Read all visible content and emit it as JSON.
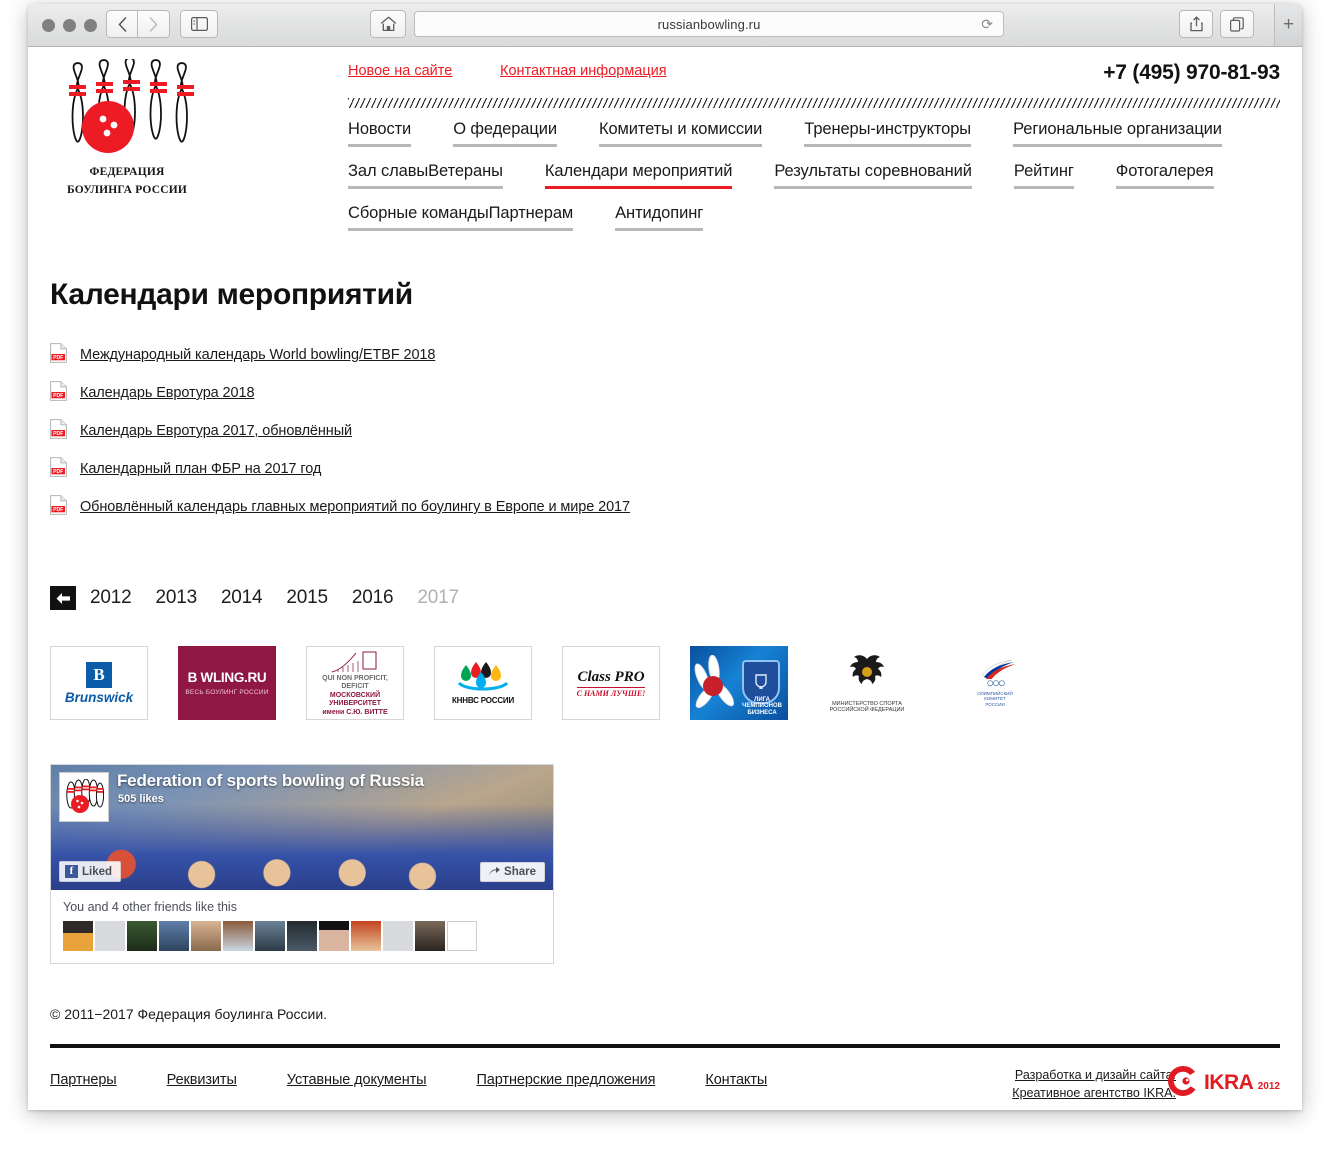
{
  "browser": {
    "url": "russianbowling.ru",
    "back_icon": "chevron-left-icon",
    "forward_icon": "chevron-right-icon",
    "sidebar_icon": "sidebar-icon",
    "home_icon": "home-icon",
    "reload_icon": "reload-icon",
    "share_icon": "share-icon",
    "tabs_icon": "tabs-icon",
    "newtab_label": "+"
  },
  "site": {
    "logo_text": "ФЕДЕРАЦИЯ\nБОУЛИНГА РОССИИ",
    "logo_line1": "ФЕДЕРАЦИЯ",
    "logo_line2": "БОУЛИНГА РОССИИ",
    "phone": "+7 (495) 970-81-93",
    "accent_red": "#ed1c24",
    "top_links": [
      {
        "label": "Новое на сайте"
      },
      {
        "label": "Контактная информация"
      }
    ],
    "menu": [
      {
        "label": "Новости",
        "active": false
      },
      {
        "label": "О федерации",
        "active": false
      },
      {
        "label": "Комитеты и комиссии",
        "active": false
      },
      {
        "label": "Тренеры-инструкторы",
        "active": false
      },
      {
        "label": "Региональные организации",
        "active": false
      },
      {
        "label": "Зал славы",
        "active": false
      },
      {
        "label": "Ветераны",
        "active": false
      },
      {
        "label": "Календари мероприятий",
        "active": true
      },
      {
        "label": "Результаты соревнований",
        "active": false
      },
      {
        "label": "Рейтинг",
        "active": false
      },
      {
        "label": "Фотогалерея",
        "active": false
      },
      {
        "label": "Сборные команды",
        "active": false
      },
      {
        "label": "Партнерам",
        "active": false
      },
      {
        "label": "Антидопинг",
        "active": false
      }
    ]
  },
  "main": {
    "title": "Календари мероприятий",
    "documents": [
      {
        "icon": "pdf-icon",
        "label": "Международный календарь World bowling/ETBF 2018"
      },
      {
        "icon": "pdf-icon",
        "label": "Календарь Евротура 2018"
      },
      {
        "icon": "pdf-icon",
        "label": "Календарь Евротура 2017, обновлённый"
      },
      {
        "icon": "pdf-icon",
        "label": "Календарный план ФБР на 2017 год"
      },
      {
        "icon": "pdf-icon",
        "label": "Обновлённый календарь главных мероприятий по боулингу в Европе и мире 2017"
      }
    ],
    "back_button_icon": "arrow-left-icon",
    "years": [
      {
        "label": "2012",
        "current": false
      },
      {
        "label": "2013",
        "current": false
      },
      {
        "label": "2014",
        "current": false
      },
      {
        "label": "2015",
        "current": false
      },
      {
        "label": "2016",
        "current": false
      },
      {
        "label": "2017",
        "current": true
      }
    ]
  },
  "sponsors": [
    {
      "name": "brunswick",
      "mark": "B",
      "title": "Brunswick"
    },
    {
      "name": "bowling-ru",
      "title": "B WLING.RU",
      "subtitle": "ВЕСЬ БОУЛИНГ РОССИИ"
    },
    {
      "name": "moscow-university",
      "line1": "МОСКОВСКИЙ",
      "line2": "УНИВЕРСИТЕТ",
      "line3": "имени С.Ю. ВИТТЕ",
      "motto": "QUI NON PROFICIT, DEFICIT"
    },
    {
      "name": "knnvs-rossii",
      "title": "КННВС РОССИИ"
    },
    {
      "name": "class-pro",
      "title": "Class PRO",
      "subtitle": "С НАМИ ЛУЧШЕ!"
    },
    {
      "name": "liga-chempionov-biznesa",
      "line1": "ЛИГА",
      "line2": "ЧЕМПИОНОВ",
      "line3": "БИЗНЕСА"
    },
    {
      "name": "ministry-of-sport",
      "line1": "МИНИСТЕРСТВО СПОРТА",
      "line2": "РОССИЙСКОЙ ФЕДЕРАЦИИ"
    },
    {
      "name": "olympic-committee",
      "line1": "ОЛИМПИЙСКИЙ",
      "line2": "КОМИТЕТ",
      "line3": "РОССИИ"
    }
  ],
  "facebook": {
    "page_title": "Federation of sports bowling of Russia",
    "likes": "505 likes",
    "liked_label": "Liked",
    "share_label": "Share",
    "friends_text": "You and 4 other friends like this",
    "face_count": 13
  },
  "footer": {
    "copyright": "© 2011−2017 Федерация боулинга России.",
    "links": [
      {
        "label": "Партнеры"
      },
      {
        "label": "Реквизиты"
      },
      {
        "label": "Уставные документы"
      },
      {
        "label": "Партнерские предложения"
      },
      {
        "label": "Контакты"
      }
    ],
    "credit_line1": "Разработка и дизайн сайта.",
    "credit_line2": "Креативное агентство IKRA.",
    "ikra_word": "IKRA",
    "ikra_year": "2012",
    "ikra_red": "#e01b22"
  }
}
